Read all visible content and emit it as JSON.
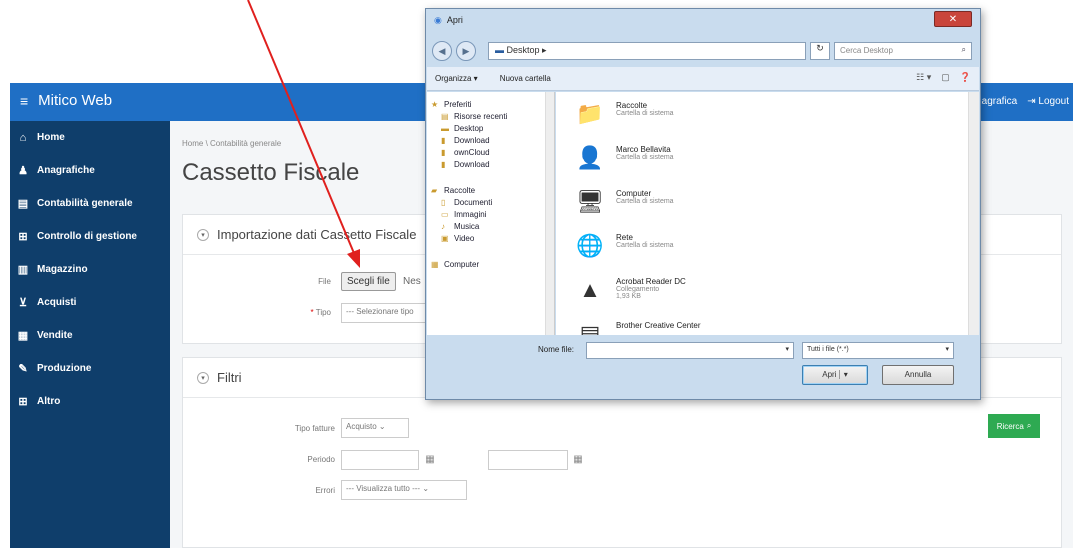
{
  "app": {
    "brand": "Mitico Web",
    "top_right": [
      "nagrafica",
      "Logout"
    ]
  },
  "sidebar": {
    "items": [
      {
        "label": "Home",
        "icon": "home-icon",
        "glyph": "⌂"
      },
      {
        "label": "Anagrafiche",
        "icon": "users-icon",
        "glyph": "♟"
      },
      {
        "label": "Contabilità generale",
        "icon": "ledger-icon",
        "glyph": "▤"
      },
      {
        "label": "Controllo di gestione",
        "icon": "chart-icon",
        "glyph": "⊞"
      },
      {
        "label": "Magazzino",
        "icon": "warehouse-icon",
        "glyph": "▥"
      },
      {
        "label": "Acquisti",
        "icon": "cart-icon",
        "glyph": "⊻"
      },
      {
        "label": "Vendite",
        "icon": "sales-icon",
        "glyph": "▦"
      },
      {
        "label": "Produzione",
        "icon": "production-icon",
        "glyph": "✎"
      },
      {
        "label": "Altro",
        "icon": "other-icon",
        "glyph": "⊞"
      }
    ]
  },
  "main": {
    "breadcrumb": "Home  \\  Contabilità generale",
    "title": "Cassetto Fiscale",
    "import_panel": {
      "heading": "Importazione dati Cassetto Fiscale",
      "file_label": "File",
      "file_button": "Scegli file",
      "file_status": "Nes",
      "tipo_label": "Tipo",
      "tipo_required": "*",
      "tipo_value": "--- Selezionare tipo"
    },
    "filters_panel": {
      "heading": "Filtri",
      "tipo_fatture_label": "Tipo fatture",
      "tipo_fatture_value": "Acquisto",
      "periodo_label": "Periodo",
      "errori_label": "Errori",
      "errori_value": "--- Visualizza tutto ---",
      "search_button": "Ricerca"
    }
  },
  "dialog": {
    "title": "Apri",
    "address": "Desktop",
    "search_placeholder": "Cerca Desktop",
    "toolbar": {
      "organize": "Organizza ▾",
      "new_folder": "Nuova cartella"
    },
    "tree": [
      {
        "label": "Preferiti",
        "glyph": "★"
      },
      {
        "label": "Risorse recenti",
        "glyph": "▤"
      },
      {
        "label": "Desktop",
        "glyph": "▬"
      },
      {
        "label": "Download",
        "glyph": "▮"
      },
      {
        "label": "ownCloud",
        "glyph": "▮"
      },
      {
        "label": "Download",
        "glyph": "▮"
      },
      {
        "label": "",
        "glyph": ""
      },
      {
        "label": "Raccolte",
        "glyph": "▰"
      },
      {
        "label": "Documenti",
        "glyph": "▯"
      },
      {
        "label": "Immagini",
        "glyph": "▭"
      },
      {
        "label": "Musica",
        "glyph": "♪"
      },
      {
        "label": "Video",
        "glyph": "▣"
      },
      {
        "label": "",
        "glyph": ""
      },
      {
        "label": "Computer",
        "glyph": "▦"
      }
    ],
    "files": [
      {
        "name": "Raccolte",
        "desc": "Cartella di sistema",
        "desc2": "",
        "glyph": "📁"
      },
      {
        "name": "Marco Bellavita",
        "desc": "Cartella di sistema",
        "desc2": "",
        "glyph": "👤"
      },
      {
        "name": "Computer",
        "desc": "Cartella di sistema",
        "desc2": "",
        "glyph": "🖥"
      },
      {
        "name": "Rete",
        "desc": "Cartella di sistema",
        "desc2": "",
        "glyph": "🌐"
      },
      {
        "name": "Acrobat Reader DC",
        "desc": "Collegamento",
        "desc2": "1,93 KB",
        "glyph": "▲"
      },
      {
        "name": "Brother Creative Center",
        "desc": "",
        "desc2": "",
        "glyph": "▤"
      }
    ],
    "filename_label": "Nome file:",
    "filter_value": "Tutti i file (*.*)",
    "open_button": "Apri",
    "cancel_button": "Annulla"
  },
  "colors": {
    "topbar": "#1f6fc5",
    "sidebar": "#0f3e6b",
    "search_button": "#2eaa52",
    "arrow": "#e0201e"
  }
}
